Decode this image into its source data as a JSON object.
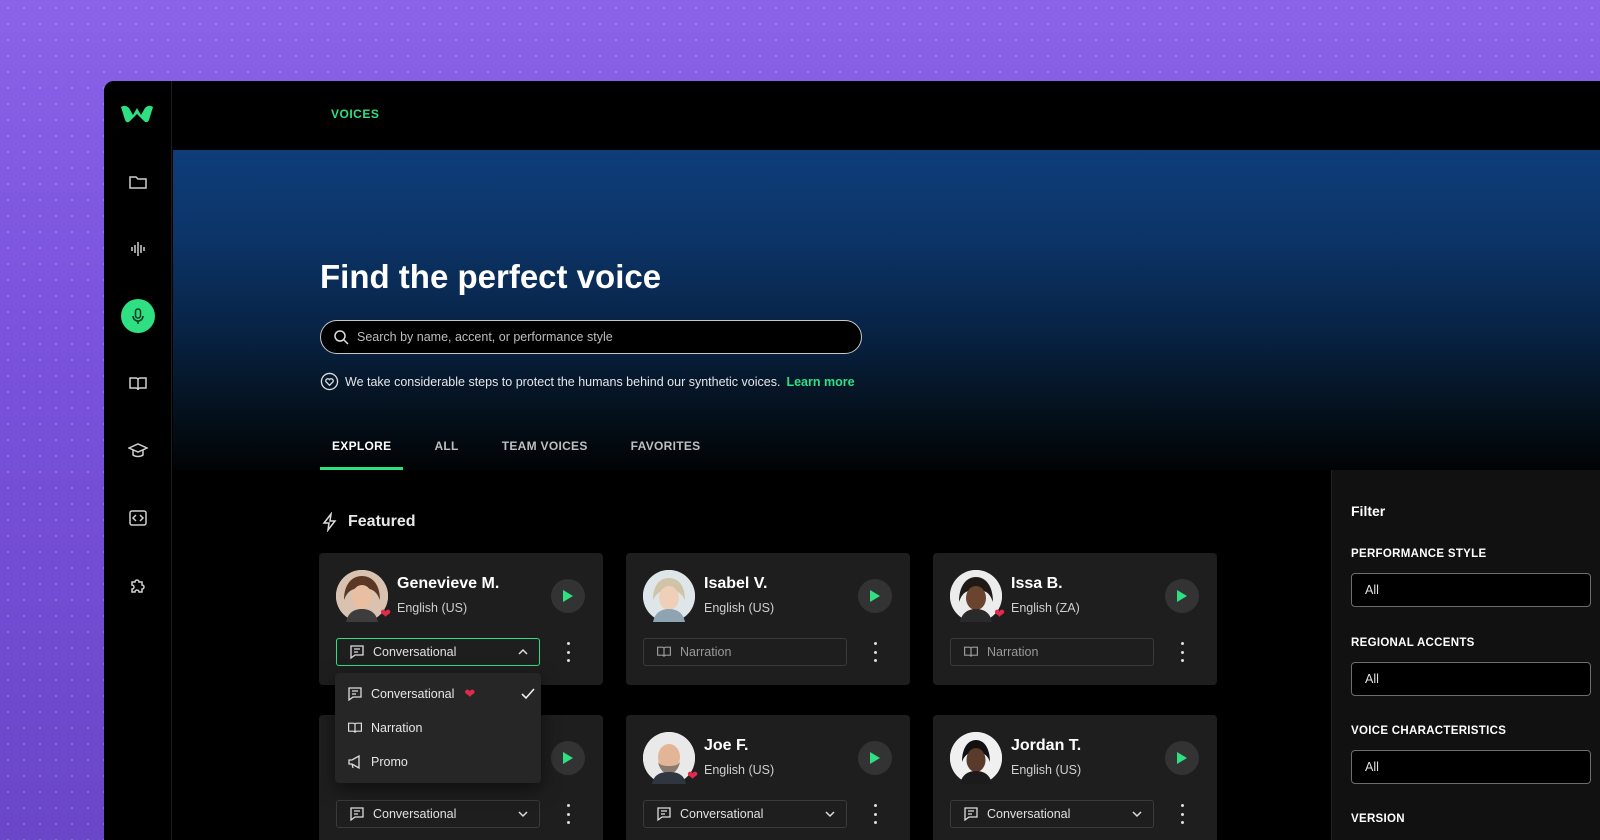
{
  "topbar": {
    "breadcrumb": "VOICES"
  },
  "hero": {
    "title": "Find the perfect voice",
    "search_placeholder": "Search by name, accent, or performance style",
    "notice_text": "We take considerable steps to protect the humans behind our synthetic voices.",
    "learn_more": "Learn more"
  },
  "tabs": [
    {
      "label": "EXPLORE",
      "active": true
    },
    {
      "label": "ALL",
      "active": false
    },
    {
      "label": "TEAM VOICES",
      "active": false
    },
    {
      "label": "FAVORITES",
      "active": false
    }
  ],
  "featured": {
    "heading": "Featured"
  },
  "voices": [
    {
      "name": "Genevieve M.",
      "language": "English (US)",
      "style": "Conversational",
      "favorite": true
    },
    {
      "name": "Isabel V.",
      "language": "English (US)",
      "style": "Narration",
      "favorite": false
    },
    {
      "name": "Issa B.",
      "language": "English (ZA)",
      "style": "Narration",
      "favorite": true
    },
    {
      "name": "",
      "language": "",
      "style": "Conversational",
      "favorite": false
    },
    {
      "name": "Joe F.",
      "language": "English (US)",
      "style": "Conversational",
      "favorite": true
    },
    {
      "name": "Jordan T.",
      "language": "English (US)",
      "style": "Conversational",
      "favorite": false
    }
  ],
  "style_menu": {
    "items": [
      {
        "label": "Conversational",
        "favorite": true,
        "selected": true
      },
      {
        "label": "Narration"
      },
      {
        "label": "Promo"
      }
    ]
  },
  "filter": {
    "title": "Filter",
    "groups": [
      {
        "label": "PERFORMANCE STYLE",
        "value": "All"
      },
      {
        "label": "REGIONAL ACCENTS",
        "value": "All"
      },
      {
        "label": "VOICE CHARACTERISTICS",
        "value": "All"
      },
      {
        "label": "VERSION"
      }
    ]
  },
  "colors": {
    "accent": "#2fe082",
    "heart": "#e02b4d",
    "card": "#1e1e1e"
  }
}
